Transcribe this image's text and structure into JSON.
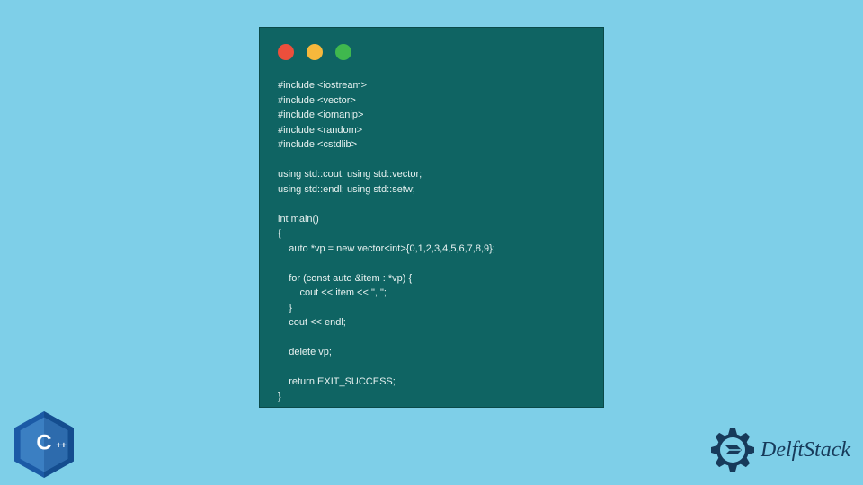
{
  "window": {
    "traffic_colors": {
      "red": "#ec4f3c",
      "yellow": "#f6b83c",
      "green": "#3fb84e"
    }
  },
  "code": {
    "lines": [
      "#include <iostream>",
      "#include <vector>",
      "#include <iomanip>",
      "#include <random>",
      "#include <cstdlib>",
      "",
      "using std::cout; using std::vector;",
      "using std::endl; using std::setw;",
      "",
      "int main()",
      "{",
      "    auto *vp = new vector<int>{0,1,2,3,4,5,6,7,8,9};",
      "",
      "    for (const auto &item : *vp) {",
      "        cout << item << \", \";",
      "    }",
      "    cout << endl;",
      "",
      "    delete vp;",
      "",
      "    return EXIT_SUCCESS;",
      "}"
    ]
  },
  "logos": {
    "cpp": {
      "label": "C++",
      "primary": "#1b5aa6",
      "secondary": "#3b7fc2"
    },
    "delft": {
      "text": "DelftStack",
      "color": "#173a5a"
    }
  }
}
